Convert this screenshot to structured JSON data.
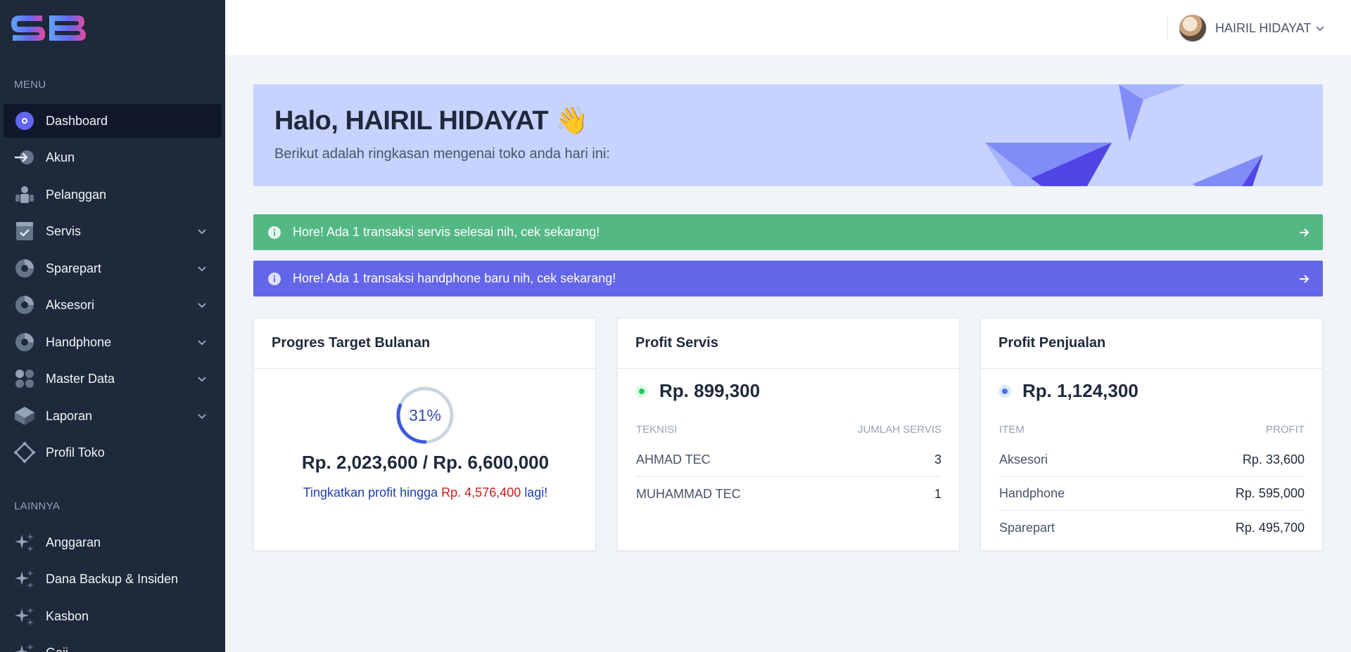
{
  "sidebar": {
    "section_menu": "MENU",
    "section_other": "LAINNYA",
    "items": [
      {
        "label": "Dashboard"
      },
      {
        "label": "Akun"
      },
      {
        "label": "Pelanggan"
      },
      {
        "label": "Servis"
      },
      {
        "label": "Sparepart"
      },
      {
        "label": "Aksesori"
      },
      {
        "label": "Handphone"
      },
      {
        "label": "Master Data"
      },
      {
        "label": "Laporan"
      },
      {
        "label": "Profil Toko"
      }
    ],
    "other_items": [
      {
        "label": "Anggaran"
      },
      {
        "label": "Dana Backup & Insiden"
      },
      {
        "label": "Kasbon"
      },
      {
        "label": "Gaji"
      }
    ]
  },
  "topbar": {
    "user_name": "HAIRIL HIDAYAT"
  },
  "banner": {
    "greeting": "Halo, HAIRIL HIDAYAT 👋",
    "subtitle": "Berikut adalah ringkasan mengenai toko anda hari ini:"
  },
  "alerts": [
    {
      "text": "Hore! Ada 1 transaksi servis selesai nih, cek sekarang!",
      "color": "#54b884"
    },
    {
      "text": "Hore! Ada 1 transaksi handphone baru nih, cek sekarang!",
      "color": "#6366e9"
    }
  ],
  "target": {
    "title": "Progres Target Bulanan",
    "percent_label": "31%",
    "progress": 0.31,
    "amount": "Rp. 2,023,600 / Rp. 6,600,000",
    "note_prefix": "Tingkatkan profit hingga ",
    "note_amount": "Rp. 4,576,400",
    "note_suffix": " lagi!"
  },
  "profit_servis": {
    "title": "Profit Servis",
    "total": "Rp. 899,300",
    "col1": "TEKNISI",
    "col2": "JUMLAH SERVIS",
    "rows": [
      {
        "name": "AHMAD TEC",
        "value": "3"
      },
      {
        "name": "MUHAMMAD TEC",
        "value": "1"
      }
    ]
  },
  "profit_penjualan": {
    "title": "Profit Penjualan",
    "total": "Rp. 1,124,300",
    "col1": "ITEM",
    "col2": "PROFIT",
    "rows": [
      {
        "name": "Aksesori",
        "value": "Rp. 33,600"
      },
      {
        "name": "Handphone",
        "value": "Rp. 595,000"
      },
      {
        "name": "Sparepart",
        "value": "Rp. 495,700"
      }
    ]
  },
  "colors": {
    "accent": "#6366e9",
    "sidebar": "#1e293b",
    "success": "#54b884",
    "banner": "#c7d2fe"
  }
}
